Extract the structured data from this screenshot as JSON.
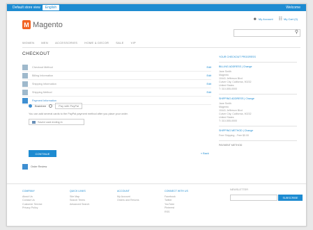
{
  "topbar": {
    "lang_label": "Default store view",
    "lang_selected": "English",
    "right_text": "Welcome"
  },
  "header": {
    "logo_text": "Magento",
    "account_label": "My Account",
    "cart_label": "My Cart (0)",
    "search_placeholder": ""
  },
  "nav": {
    "items": [
      "WOMEN",
      "MEN",
      "ACCESSORIES",
      "HOME & DECOR",
      "SALE",
      "VIP"
    ]
  },
  "page_title": "CHECKOUT",
  "steps": [
    {
      "label": "Checkout Method",
      "edit": "Edit"
    },
    {
      "label": "Billing Information",
      "edit": "Edit"
    },
    {
      "label": "Shipping Information",
      "edit": "Edit"
    },
    {
      "label": "Shipping Method",
      "edit": "Edit"
    },
    {
      "label": "Payment Information",
      "edit": ""
    }
  ],
  "payment": {
    "option_1": "Braintree",
    "option_2": "Pay with PayPal",
    "note": "You can add several cards to the PayPal payment method after you place your order.",
    "card_label": "Saved card ending in",
    "continue_label": "CONTINUE",
    "back_label": "« Back"
  },
  "review_label": "Order Review",
  "sidebar": {
    "title": "YOUR CHECKOUT PROGRESS",
    "billing_title": "BILLING ADDRESS | Change",
    "billing_lines": [
      "Jane Smith",
      "Magento",
      "10441 Jefferson Blvd",
      "Culver City, California, 90232",
      "United States",
      "T: 310-555-0000"
    ],
    "shipping_title": "SHIPPING ADDRESS | Change",
    "shipping_lines": [
      "Jane Smith",
      "Magento",
      "10441 Jefferson Blvd",
      "Culver City, California, 90232",
      "United States",
      "T: 310-555-0000"
    ],
    "method_title": "SHIPPING METHOD | Change",
    "method_value": "Free Shipping - Free $0.00",
    "payment_title": "PAYMENT METHOD"
  },
  "footer": {
    "col1": {
      "title": "COMPANY",
      "links": [
        "About Us",
        "Contact Us",
        "Customer Service",
        "Privacy Policy"
      ]
    },
    "col2": {
      "title": "QUICK LINKS",
      "links": [
        "Site Map",
        "Search Terms",
        "Advanced Search"
      ]
    },
    "col3": {
      "title": "ACCOUNT",
      "links": [
        "My Account",
        "Orders and Returns"
      ]
    },
    "col4": {
      "title": "CONNECT WITH US",
      "links": [
        "Facebook",
        "Twitter",
        "YouTube",
        "Pinterest",
        "RSS"
      ]
    },
    "newsletter_title": "NEWSLETTER",
    "subscribe_label": "SUBSCRIBE"
  }
}
